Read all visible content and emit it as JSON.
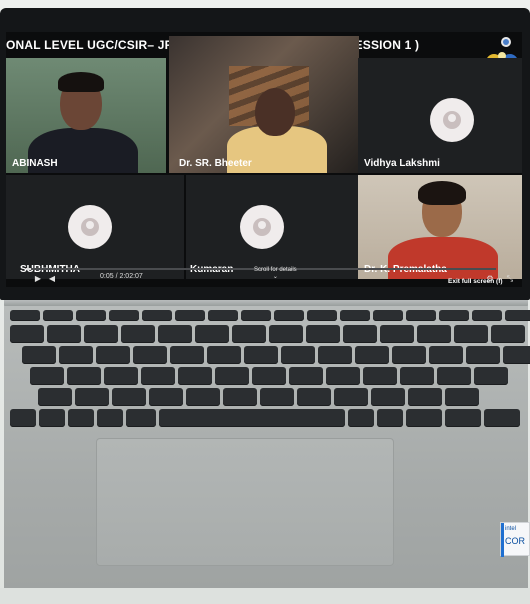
{
  "meeting": {
    "title": "ONAL LEVEL UGC/CSIR– JRF/NET WORKSHOP ( DAY 1 – SESSION 1 )",
    "logo_icon": "institution-emblem-icon"
  },
  "participants": [
    {
      "name": "ABINASH",
      "video": true
    },
    {
      "name": "Dr. SR. Bheeter",
      "video": true
    },
    {
      "name": "Vidhya Lakshmi",
      "video": false
    },
    {
      "name": "SUBHMITHA",
      "video": false
    },
    {
      "name": "Kumaran",
      "video": false
    },
    {
      "name": "Dr. K. Premalatha",
      "video": true
    }
  ],
  "player": {
    "timecode": "0:05 / 2:02:07",
    "progress": 0.01,
    "scroll_hint": "Scroll for details",
    "exit_fullscreen": "Exit full screen (f)",
    "play_icon": "play-icon",
    "volume_icon": "volume-icon",
    "settings_icon": "gear-icon",
    "fullscreen_icon": "exit-fullscreen-icon"
  },
  "laptop": {
    "sticker_brand": "intel",
    "sticker_text": "COR"
  },
  "colors": {
    "bezel": "#141618",
    "screen_bg": "#0b0c0d",
    "tile_bg": "#1e2022",
    "avatar_bg": "#f0ecec",
    "deck": "#aeb2b1",
    "keys": "#2b2e31",
    "intel_blue": "#0a4fa0"
  }
}
